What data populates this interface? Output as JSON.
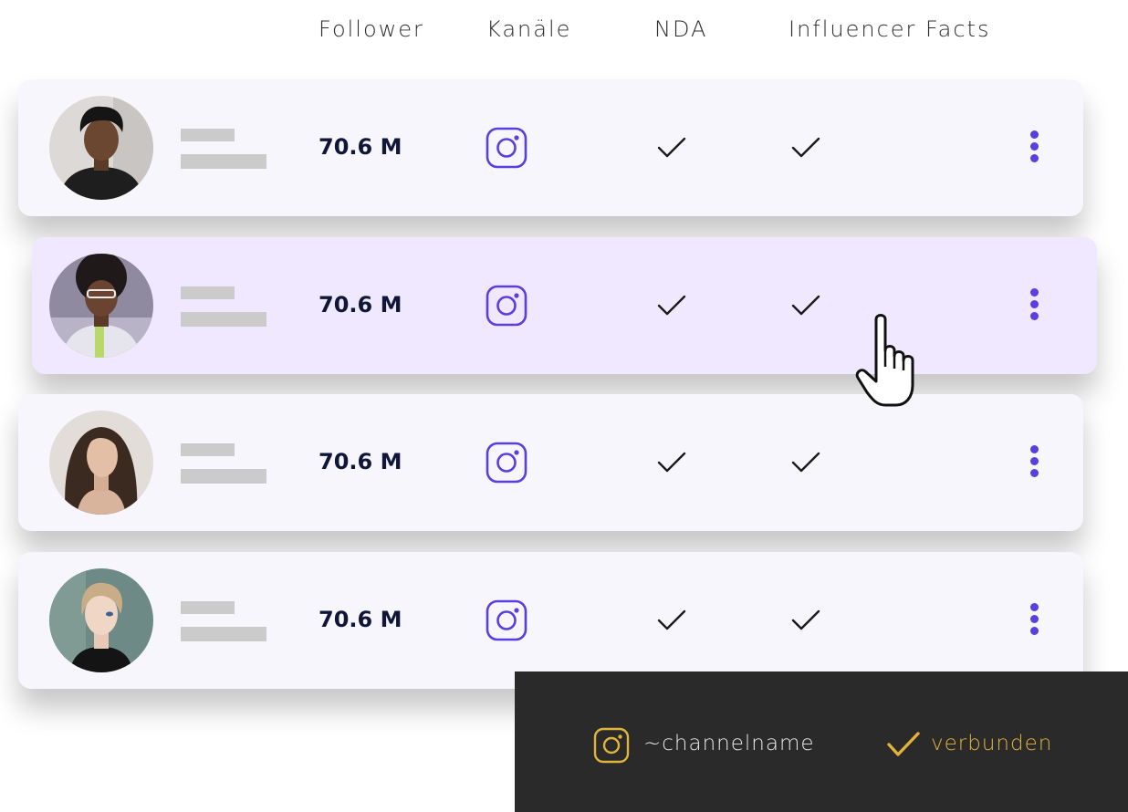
{
  "columns": {
    "follower": "Follower",
    "channels": "Kanäle",
    "nda": "NDA",
    "facts": "Influencer Facts"
  },
  "rows": [
    {
      "followers": "70.6 M",
      "channel_icon": "instagram-icon",
      "nda": true,
      "facts": true,
      "highlighted": false
    },
    {
      "followers": "70.6 M",
      "channel_icon": "instagram-icon",
      "nda": true,
      "facts": true,
      "highlighted": true
    },
    {
      "followers": "70.6 M",
      "channel_icon": "instagram-icon",
      "nda": true,
      "facts": true,
      "highlighted": false
    },
    {
      "followers": "70.6 M",
      "channel_icon": "instagram-icon",
      "nda": true,
      "facts": true,
      "highlighted": false
    }
  ],
  "toast": {
    "channel_name": "~channelname",
    "status": "verbunden",
    "channel_icon": "instagram-icon",
    "status_icon": "check-icon"
  },
  "colors": {
    "accent": "#5b3ee0",
    "row_bg": "#f7f6fd",
    "row_active_bg": "#f0e8fe",
    "toast_bg": "#2a2a2a",
    "toast_accent": "#e0b43a"
  }
}
